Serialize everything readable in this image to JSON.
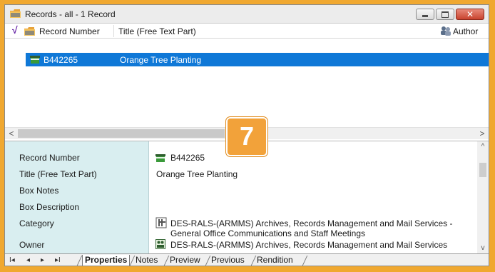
{
  "window": {
    "title": "Records - all - 1 Record",
    "minimize_icon": "minimize-icon",
    "maximize_icon": "maximize-icon",
    "close_icon": "close-icon",
    "close_glyph": "✕"
  },
  "columns": {
    "check_glyph": "√",
    "record_number": "Record Number",
    "title": "Title (Free Text Part)",
    "author": "Author"
  },
  "records": [
    {
      "record_number": "B442265",
      "title": "Orange Tree Planting"
    }
  ],
  "scroll": {
    "left_arrow": "<",
    "right_arrow": ">",
    "up_arrow": "^",
    "down_arrow": "v"
  },
  "properties": {
    "labels": {
      "record_number": "Record Number",
      "title": "Title (Free Text Part)",
      "box_notes": "Box Notes",
      "box_description": "Box Description",
      "category": "Category",
      "owner": "Owner"
    },
    "values": {
      "record_number": "B442265",
      "title": "Orange Tree Planting",
      "category_line1": "DES-RALS-(ARMMS) Archives, Records Management and Mail Services -",
      "category_line2": "General Office Communications and Staff Meetings",
      "owner": "DES-RALS-(ARMMS) Archives, Records Management and Mail Services"
    }
  },
  "nav": {
    "first": "I◂",
    "prev": "◂",
    "next": "▸",
    "last": "▸I"
  },
  "tabs": [
    "Properties",
    "Notes",
    "Preview",
    "Previous",
    "Rendition"
  ],
  "active_tab": "Properties",
  "badge": "7",
  "colors": {
    "selection": "#0f78d7",
    "label_pane": "#d9eef0",
    "badge": "#f2a23a",
    "border": "#f0a830"
  }
}
